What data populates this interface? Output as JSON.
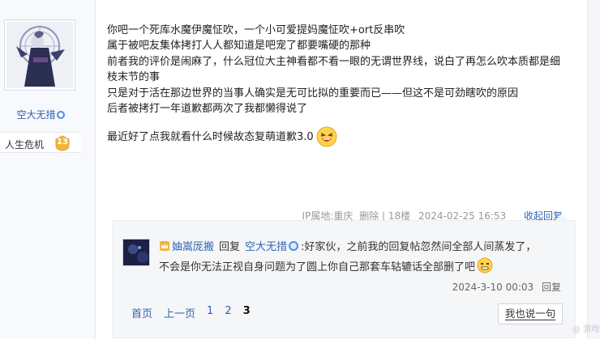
{
  "author": {
    "username": "空大无措",
    "vip_icon": "vip-ring-icon",
    "level_name": "人生危机",
    "level": "13"
  },
  "post": {
    "lines": [
      "你吧一个死库水魔伊魔怔吹，一个小可爱提妈魔怔吹+ort反串吹",
      "属于被吧友集体拷打人人都知道是吧宠了都要嘴硬的那种",
      "前者我的评价是闹麻了，什么冠位大主神看都不看一眼的无谓世界线，说白了再怎么吹本质都是细枝末节的事",
      "只是对于活在那边世界的当事人确实是无可比拟的重要而已——但这不是可劲瞎吹的原因",
      "后者被拷打一年道歉都两次了我都懒得说了"
    ],
    "last_line": "最近好了点我就看什么时候故态复萌道歉3.0",
    "emoji": "laughing-emoji"
  },
  "meta": {
    "ip": "IP属地:重庆",
    "delete": "删除",
    "floor": "18楼",
    "datetime": "2024-02-25 16:53",
    "collapse_reply": "收起回复"
  },
  "reply": {
    "user": "妯嵩厐搬",
    "reply_word": "回复",
    "target": "空大无措",
    "text1": ":好家伙，之前我的回复帖忽然间全部人间蒸发了，",
    "text2": "不会是你无法正视自身问题为了圆上你自己那套车轱辘话全部删了吧",
    "emoji": "awkward-emoji",
    "datetime": "2024-3-10 00:03",
    "reply_label": "回复"
  },
  "pager": {
    "first": "首页",
    "prev": "上一页",
    "p1": "1",
    "p2": "2",
    "p3": "3"
  },
  "say_button": "我也说一句",
  "watermark": "@ 游戏情报",
  "colors": {
    "link": "#2d64b3",
    "badge": "#f0b63a",
    "reply_bg": "#f5f6f8"
  }
}
